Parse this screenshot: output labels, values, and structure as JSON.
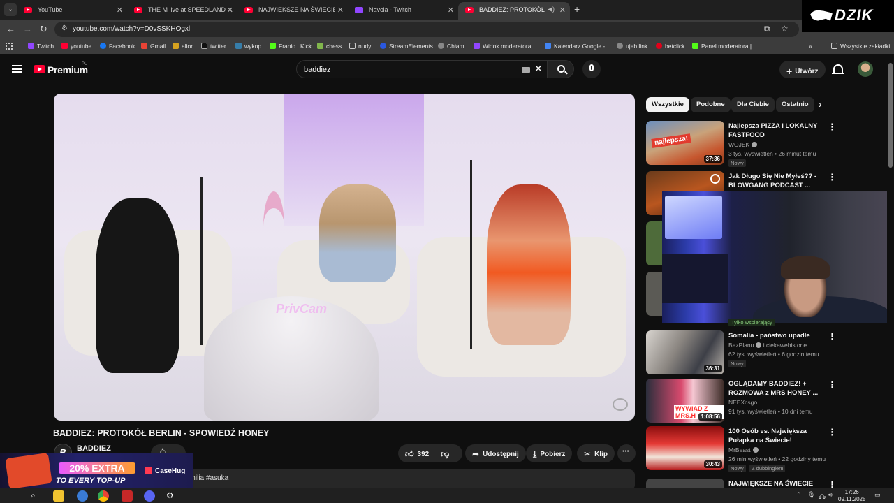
{
  "browser": {
    "tabs": [
      {
        "title": "YouTube",
        "icon": "youtube-icon"
      },
      {
        "title": "THE M live at SPEEDLAND FEST",
        "icon": "youtube-icon"
      },
      {
        "title": "NAJWIĘKSZE NA ŚWIECIE ZAW",
        "icon": "youtube-icon"
      },
      {
        "title": "Navcia - Twitch",
        "icon": "twitch-icon"
      },
      {
        "title": "BADDIEZ: PROTOKÓŁ BERLI",
        "icon": "youtube-icon"
      }
    ],
    "url": "youtube.com/watch?v=D0vSSKHOgxl",
    "bookmarks": [
      "Twitch",
      "youtube",
      "Facebook",
      "Gmail",
      "alior",
      "twitter",
      "wykop",
      "Franio | Kick",
      "chess",
      "nudy",
      "StreamElements",
      "Chłam",
      "Widok moderatora...",
      "Kalendarz Google -...",
      "ujeb link",
      "betclick",
      "Panel moderatora |..."
    ],
    "all_bookmarks": "Wszystkie zakładki"
  },
  "overlay_brand": "DZIK",
  "youtube": {
    "logo_text": "Premium",
    "logo_suffix": "PL",
    "search_query": "baddiez",
    "create_label": "Utwórz"
  },
  "video": {
    "title": "BADDIEZ: PROTOKÓŁ BERLIN - SPOWIEDŹ HONEY",
    "watermark": "PrivCam",
    "channel": "BADDIEZ",
    "channel_initial": "B",
    "likes": "392",
    "share_label": "Udostępnij",
    "download_label": "Pobierz",
    "clip_label": "Klip",
    "description_snippet": "emilia #asuka"
  },
  "chips": [
    "Wszystkie",
    "Podobne",
    "Dla Ciebie",
    "Ostatnio"
  ],
  "recommendations": [
    {
      "title": "Najlepsza PIZZA i LOKALNY FASTFOOD",
      "channel": "WOJEK",
      "verified": true,
      "meta": "3 tys. wyświetleń • 26 minut temu",
      "badge": "Nowy",
      "duration": "37:36",
      "thumb_text": "najlepsza!"
    },
    {
      "title": "Jak Długo Się Nie Myłeś?? - BLOWGANG PODCAST ...",
      "channel": "",
      "meta": "",
      "badge": "",
      "duration": ""
    },
    {
      "title": "Somalia - państwo upadłe",
      "channel": "BezPlanu",
      "channel_extra": "i ciekawehistorie",
      "verified": true,
      "meta": "62 tys. wyświetleń • 6 godzin temu",
      "badge": "Nowy",
      "duration": "36:31"
    },
    {
      "title": "OGLĄDAMY BADDIEZ! + ROZMOWA z MRS HONEY ...",
      "channel": "NEEXcsgo",
      "verified": false,
      "meta": "91 tys. wyświetleń • 10 dni temu",
      "badge": "",
      "duration": "1:08:56",
      "thumb_text": "WYWIAD Z MRS.H"
    },
    {
      "title": "100 Osób vs. Największa Pułapka na Świecie!",
      "channel": "MrBeast",
      "verified": true,
      "meta": "26 mln wyświetleń • 22 godziny temu",
      "badge": "Nowy",
      "badge2": "Z dubbingiem",
      "duration": "30:43"
    },
    {
      "title": "NAJWIĘKSZE NA ŚWIECIE",
      "channel": "",
      "meta": "",
      "badge": "",
      "duration": ""
    }
  ],
  "only_subscribers": "Tylko wspierający",
  "ad": {
    "headline": "20% EXTRA",
    "subline": "TO EVERY TOP-UP",
    "brand": "CaseHug"
  },
  "taskbar": {
    "time": "17:26",
    "date": "09.11.2025"
  }
}
